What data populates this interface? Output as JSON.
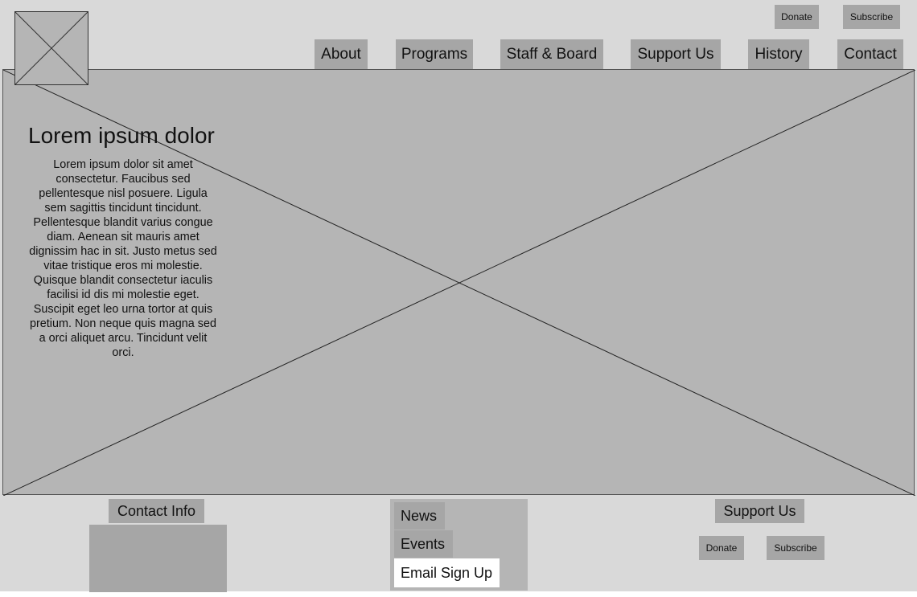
{
  "utility": {
    "donate_label": "Donate",
    "subscribe_label": "Subscribe"
  },
  "nav": {
    "items": [
      {
        "label": "About"
      },
      {
        "label": "Programs"
      },
      {
        "label": "Staff & Board"
      },
      {
        "label": "Support Us"
      },
      {
        "label": "History"
      },
      {
        "label": "Contact"
      }
    ]
  },
  "hero": {
    "title": "Lorem ipsum dolor",
    "body": "Lorem ipsum dolor sit amet consectetur. Faucibus sed pellentesque nisl posuere. Ligula sem sagittis tincidunt tincidunt. Pellentesque blandit varius congue diam. Aenean sit mauris amet dignissim hac in sit. Justo metus sed vitae tristique eros mi molestie. Quisque blandit consectetur iaculis facilisi id dis mi molestie eget. Suscipit eget leo urna tortor at quis pretium. Non neque quis magna sed a orci aliquet arcu. Tincidunt velit orci."
  },
  "footer": {
    "contact_label": "Contact Info",
    "news_label": "News",
    "events_label": "Events",
    "email_label": "Email Sign Up",
    "support_label": "Support Us",
    "donate_label": "Donate",
    "subscribe_label": "Subscribe"
  },
  "colors": {
    "page_bg": "#d9d9d9",
    "placeholder_bg": "#b5b5b5",
    "button_bg": "#a6a6a6"
  }
}
